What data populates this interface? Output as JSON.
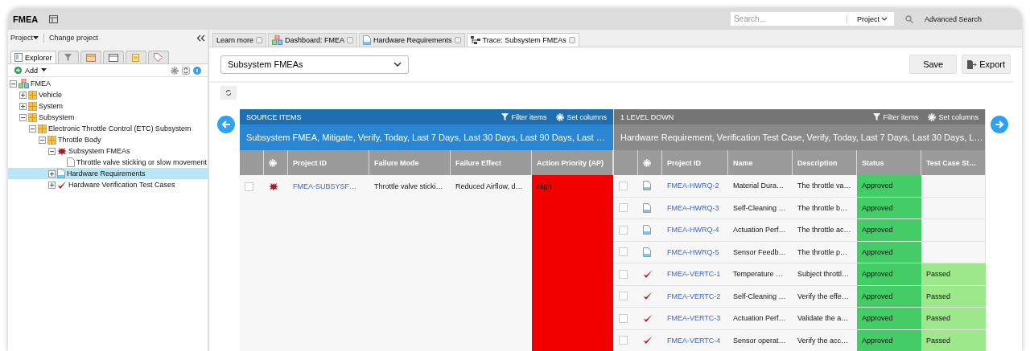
{
  "app": {
    "title": "FMEA"
  },
  "search": {
    "placeholder": "Search...",
    "scope": "Project",
    "advanced": "Advanced Search"
  },
  "sidebar": {
    "project_menu": "Project",
    "change_project": "Change project",
    "tabs": [
      {
        "kind": "explorer",
        "label": "Explorer",
        "selected": true
      },
      {
        "kind": "filter",
        "selected": false
      },
      {
        "kind": "calendar",
        "selected": false
      },
      {
        "kind": "window",
        "selected": false
      },
      {
        "kind": "clipboard",
        "selected": false
      },
      {
        "kind": "tag",
        "selected": false
      }
    ],
    "add": "Add",
    "tree": [
      {
        "kind": "project",
        "label": "FMEA",
        "expanded": true,
        "selected": false,
        "children": [
          {
            "kind": "folder",
            "label": "Vehicle",
            "expanded": false,
            "selected": false
          },
          {
            "kind": "folder",
            "label": "System",
            "expanded": false,
            "selected": false
          },
          {
            "kind": "folder",
            "label": "Subsystem",
            "expanded": true,
            "selected": false,
            "children": [
              {
                "kind": "folder",
                "label": "Electronic Throttle Control (ETC) Subsystem",
                "expanded": true,
                "selected": false,
                "children": [
                  {
                    "kind": "folder",
                    "label": "Throttle Body",
                    "expanded": true,
                    "selected": false,
                    "children": [
                      {
                        "kind": "fmea",
                        "label": "Subsystem FMEAs",
                        "expanded": true,
                        "selected": false,
                        "children": [
                          {
                            "kind": "doc",
                            "label": "Throttle valve sticking or slow movement",
                            "selected": false
                          }
                        ]
                      },
                      {
                        "kind": "requirement",
                        "label": "Hardware Requirements",
                        "expanded": false,
                        "selected": true
                      },
                      {
                        "kind": "test",
                        "label": "Hardware Verification Test Cases",
                        "expanded": false,
                        "selected": false
                      }
                    ]
                  }
                ]
              }
            ]
          }
        ]
      }
    ]
  },
  "doc_tabs": [
    {
      "kind": "plain",
      "label": "Learn more",
      "selected": false
    },
    {
      "kind": "dashboard",
      "label": "Dashboard: FMEA",
      "selected": false
    },
    {
      "kind": "requirement",
      "label": "Hardware Requirements",
      "selected": false
    },
    {
      "kind": "trace",
      "label": "Trace: Subsystem FMEAs",
      "selected": true
    }
  ],
  "view_select": "Subsystem FMEAs",
  "buttons": {
    "save": "Save",
    "export": "Export"
  },
  "source": {
    "title": "SOURCE ITEMS",
    "filter": "Filter items",
    "columns_btn": "Set columns",
    "summary": "Subsystem FMEA, Mitigate, Verify, Today, Last 7 Days, Last 30 Days, Last 90 Days, Last …",
    "columns": [
      "Project ID",
      "Failure Mode",
      "Failure Effect",
      "Action Priority (AP)"
    ],
    "rows": [
      {
        "kind": "fmea",
        "checked": false,
        "id": "FMEA-SUBSYSF…",
        "mode": "Throttle valve sticki…",
        "effect": "Reduced Airflow, d…",
        "priority": {
          "text": "High",
          "color": "#f20000"
        }
      }
    ]
  },
  "target": {
    "title": "1 LEVEL DOWN",
    "filter": "Filter items",
    "columns_btn": "Set columns",
    "summary": "Hardware Requirement, Verification Test Case, Verify, Today, Last 7 Days, Last 30 Days, L…",
    "columns": [
      "Project ID",
      "Name",
      "Description",
      "Status",
      "Test Case St…"
    ],
    "rows": [
      {
        "kind": "requirement",
        "checked": false,
        "id": "FMEA-HWRQ-2",
        "name": "Material Dura…",
        "description": "The throttle va…",
        "status": {
          "text": "Approved",
          "color": "#44cc66"
        }
      },
      {
        "kind": "requirement",
        "checked": false,
        "id": "FMEA-HWRQ-3",
        "name": "Self-Cleaning …",
        "description": "The throttle b…",
        "status": {
          "text": "Approved",
          "color": "#44cc66"
        }
      },
      {
        "kind": "requirement",
        "checked": false,
        "id": "FMEA-HWRQ-4",
        "name": "Actuation Perf…",
        "description": "The throttle ac…",
        "status": {
          "text": "Approved",
          "color": "#44cc66"
        }
      },
      {
        "kind": "requirement",
        "checked": false,
        "id": "FMEA-HWRQ-5",
        "name": "Sensor Feedb…",
        "description": "The throttle p…",
        "status": {
          "text": "Approved",
          "color": "#44cc66"
        }
      },
      {
        "kind": "test",
        "checked": false,
        "id": "FMEA-VERTC-1",
        "name": "Temperature …",
        "description": "Subject throttl…",
        "status": {
          "text": "Approved",
          "color": "#44cc66"
        },
        "result": {
          "text": "Passed",
          "color": "#9de88a"
        }
      },
      {
        "kind": "test",
        "checked": false,
        "id": "FMEA-VERTC-2",
        "name": "Self-Cleaning …",
        "description": "Verify the effe…",
        "status": {
          "text": "Approved",
          "color": "#44cc66"
        },
        "result": {
          "text": "Passed",
          "color": "#9de88a"
        }
      },
      {
        "kind": "test",
        "checked": false,
        "id": "FMEA-VERTC-3",
        "name": "Actuation Perf…",
        "description": "Validate the a…",
        "status": {
          "text": "Approved",
          "color": "#44cc66"
        },
        "result": {
          "text": "Passed",
          "color": "#9de88a"
        }
      },
      {
        "kind": "test",
        "checked": false,
        "id": "FMEA-VERTC-4",
        "name": "Sensor operat…",
        "description": "Verify the acc…",
        "status": {
          "text": "Approved",
          "color": "#44cc66"
        },
        "result": {
          "text": "Passed",
          "color": "#9de88a"
        }
      }
    ]
  }
}
